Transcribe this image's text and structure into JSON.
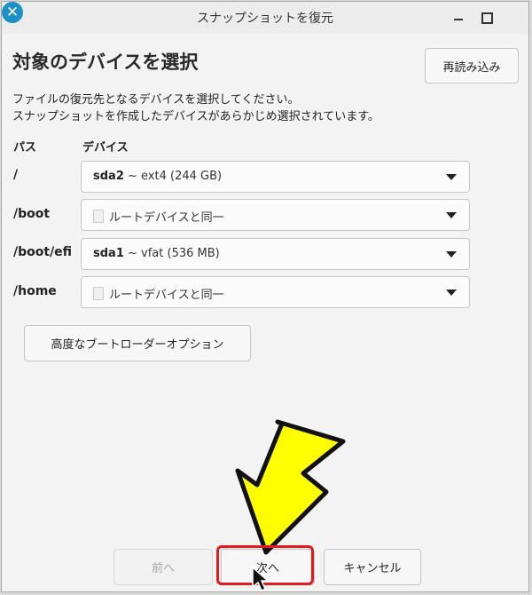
{
  "window": {
    "title": "スナップショットを復元"
  },
  "header": {
    "heading": "対象のデバイスを選択",
    "reload_label": "再読み込み"
  },
  "description": {
    "line1": "ファイルの復元先となるデバイスを選択してください。",
    "line2": "スナップショットを作成したデバイスがあらかじめ選択されています。"
  },
  "columns": {
    "path": "パス",
    "device": "デバイス"
  },
  "rows": [
    {
      "path": "/",
      "device_name": "sda2",
      "device_detail": " ~ ext4 (244 GB)"
    },
    {
      "path": "/boot",
      "device_name": "",
      "device_detail": "ルートデバイスと同一"
    },
    {
      "path": "/boot/efi",
      "device_name": "sda1",
      "device_detail": " ~ vfat (536 MB)"
    },
    {
      "path": "/home",
      "device_name": "",
      "device_detail": "ルートデバイスと同一"
    }
  ],
  "advanced_label": "高度なブートローダーオプション",
  "footer": {
    "prev_label": "前へ",
    "next_label": "次へ",
    "cancel_label": "キャンセル"
  },
  "annotation": {
    "arrow_color": "#ffff00",
    "highlight_color": "#e01b1b"
  },
  "icons": {
    "minimize": "minimize-icon",
    "maximize": "maximize-icon",
    "close": "close-icon",
    "dropdown": "chevron-down-icon"
  }
}
